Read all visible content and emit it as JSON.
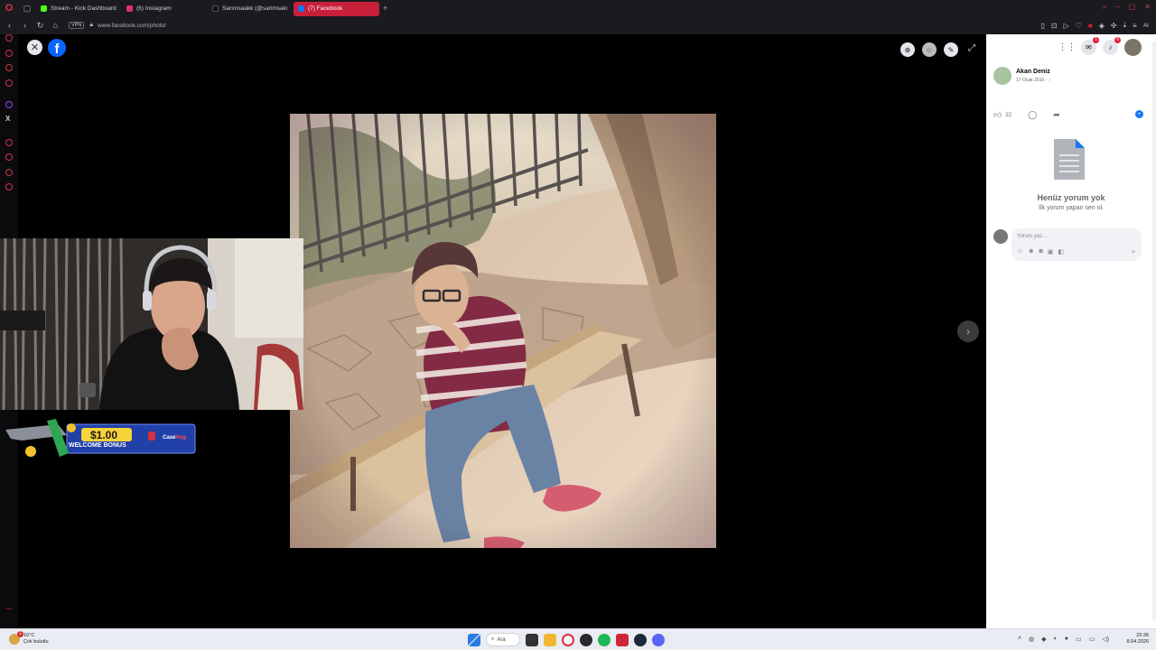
{
  "browser": {
    "tabs": [
      {
        "label": "Stream - Kick Dashboard",
        "color": "#53fc18"
      },
      {
        "label": "(6) Instagram",
        "color": "#e1306c"
      },
      {
        "label": "Sarımsaakk (@sarimsakı",
        "color": "#111111"
      },
      {
        "label": "(7) Facebook",
        "color": "#1877f2"
      }
    ],
    "vpn_label": "VPN",
    "url": "www.facebook.com/photo/",
    "ai_label": "AI"
  },
  "viewer": {
    "close_symbol": "✕",
    "logo_letter": "f",
    "next_symbol": "›"
  },
  "promo": {
    "amount": "$1.00",
    "caption": "WELCOME BONUS",
    "brand_prefix": "Case",
    "brand_suffix": "Hug"
  },
  "fb_panel": {
    "author_name": "Akan Deniz",
    "post_date": "17 Ocak 2016 ·",
    "like_count": "22",
    "messenger_badge": "1",
    "notif_badge": "6",
    "no_comment_title": "Henüz yorum yok",
    "no_comment_sub": "İlk yorum yapan sen ol.",
    "comment_placeholder": "Yorum yaz..."
  },
  "taskbar": {
    "temp": "16°C",
    "weather": "Çok bulutlu",
    "weather_badge": "1",
    "search_label": "Ara",
    "time": "22:36",
    "date": "8.04.2026"
  },
  "colors": {
    "accent_red": "#c8203a",
    "fb_blue": "#1877f2",
    "fb_logo": "#0866ff"
  }
}
